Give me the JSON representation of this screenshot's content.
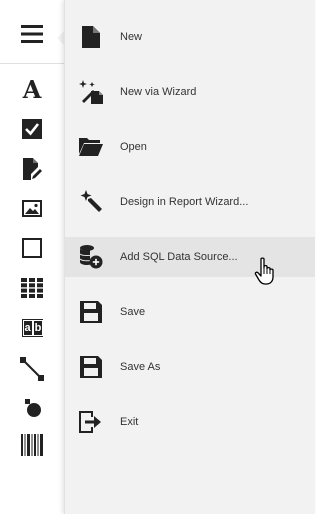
{
  "toolbox": {
    "menu_icon": "hamburger-menu-icon",
    "tools": [
      {
        "icon": "text-label-icon",
        "glyph": "A"
      },
      {
        "icon": "checkbox-icon"
      },
      {
        "icon": "rich-text-icon"
      },
      {
        "icon": "picture-icon"
      },
      {
        "icon": "panel-icon"
      },
      {
        "icon": "table-icon"
      },
      {
        "icon": "character-comb-icon",
        "glyph_left": "a",
        "glyph_right": "b"
      },
      {
        "icon": "line-icon"
      },
      {
        "icon": "shape-icon"
      },
      {
        "icon": "barcode-icon"
      }
    ]
  },
  "menu": {
    "items": [
      {
        "label": "New",
        "icon": "new-document-icon"
      },
      {
        "label": "New via Wizard",
        "icon": "wizard-new-icon"
      },
      {
        "label": "Open",
        "icon": "open-folder-icon"
      },
      {
        "label": "Design in Report Wizard...",
        "icon": "magic-wand-icon"
      },
      {
        "label": "Add SQL Data Source...",
        "icon": "add-database-icon",
        "hovered": true
      },
      {
        "label": "Save",
        "icon": "save-icon"
      },
      {
        "label": "Save As",
        "icon": "save-as-icon"
      },
      {
        "label": "Exit",
        "icon": "exit-icon"
      }
    ]
  },
  "colors": {
    "icon": "#222222",
    "menu_background": "#f2f2f2",
    "hover_background": "#e4e4e4",
    "text": "#333333"
  }
}
